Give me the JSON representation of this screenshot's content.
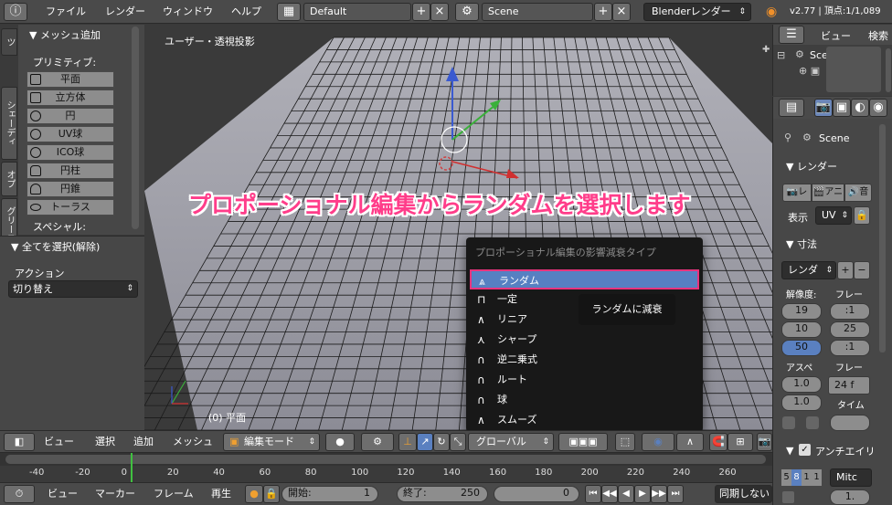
{
  "topbar": {
    "menus": [
      "ファイル",
      "レンダー",
      "ウィンドウ",
      "ヘルプ"
    ],
    "layout_name": "Default",
    "scene_name": "Scene",
    "render_engine": "Blenderレンダー",
    "version_info": "v2.77 | 頂点:1/1,089"
  },
  "tool_shelf": {
    "tabs": [
      "ツ",
      "シェーディ",
      "オプ",
      "グリース"
    ],
    "panel_title": "▼ メッシュ追加",
    "primitives_label": "プリミティブ:",
    "primitives": [
      "平面",
      "立方体",
      "円",
      "UV球",
      "ICO球",
      "円柱",
      "円錐",
      "トーラス"
    ],
    "special_label": "スペシャル:"
  },
  "operator_panel": {
    "title": "▼ 全てを選択(解除)",
    "action_label": "アクション",
    "action_value": "切り替え"
  },
  "viewport": {
    "view_label": "ユーザー・透視投影",
    "object_label": "(0) 平面",
    "caption": "プロポーショナル編集からランダムを選択します"
  },
  "falloff_menu": {
    "title": "プロポーショナル編集の影響減衰タイプ",
    "items": [
      {
        "icon": "⩓",
        "label": "ランダム"
      },
      {
        "icon": "⊓",
        "label": "一定"
      },
      {
        "icon": "∧",
        "label": "リニア"
      },
      {
        "icon": "⋏",
        "label": "シャープ"
      },
      {
        "icon": "∩",
        "label": "逆二乗式"
      },
      {
        "icon": "∩",
        "label": "ルート"
      },
      {
        "icon": "∩",
        "label": "球"
      },
      {
        "icon": "∧",
        "label": "スムーズ"
      }
    ],
    "tooltip": "ランダムに減衰"
  },
  "outliner": {
    "view_menu": "ビュー",
    "search_menu": "検索",
    "scene_item": "Sce"
  },
  "properties": {
    "context_label": "Scene",
    "render_panel": "▼ レンダー",
    "render_buttons": [
      "レ",
      "アニ",
      "音"
    ],
    "display_label": "表示",
    "display_value": "UV",
    "dimensions_panel": "▼ 寸法",
    "preset_value": "レンダ",
    "resolution_label": "解像度:",
    "frame_rate_label": "フレー",
    "res_values": [
      "19",
      "10",
      "50"
    ],
    "frame_values": [
      ":1",
      "25",
      ":1"
    ],
    "aspect_label": "アスペ",
    "aspect_values": [
      "1.0",
      "1.0"
    ],
    "fps_label": "フレー",
    "fps_value": "24 f",
    "time_label": "タイム",
    "aa_panel": "アンチエイリ",
    "aa_samples": [
      "5",
      "8",
      "1",
      "1"
    ],
    "aa_filter": "Mitc",
    "aa_value": "1."
  },
  "header_3d": {
    "menus": [
      "ビュー",
      "選択",
      "追加",
      "メッシュ"
    ],
    "mode": "編集モード",
    "pivot": "グローバル"
  },
  "timeline": {
    "ruler": [
      "-40",
      "-20",
      "0",
      "20",
      "40",
      "60",
      "80",
      "100",
      "120",
      "140",
      "160",
      "180",
      "200",
      "220",
      "240",
      "260"
    ]
  },
  "timeline_header": {
    "menus": [
      "ビュー",
      "マーカー",
      "フレーム",
      "再生"
    ],
    "start_label": "開始:",
    "start_value": "1",
    "end_label": "終了:",
    "end_value": "250",
    "current_value": "0",
    "sync": "同期しない"
  }
}
